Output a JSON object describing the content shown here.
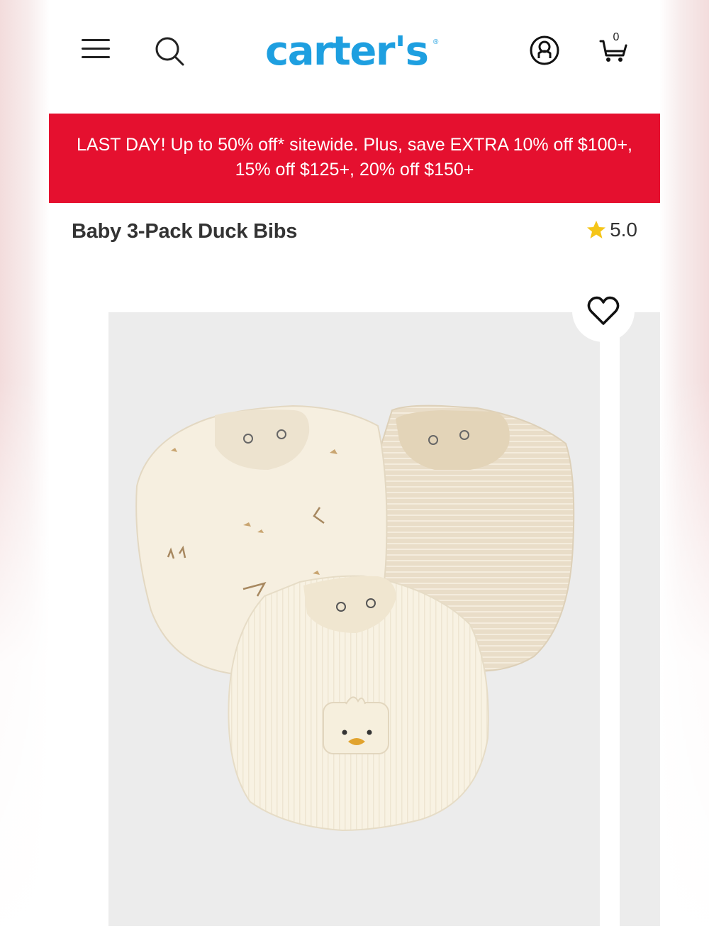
{
  "brand": {
    "name": "carter's",
    "registered_mark": "®"
  },
  "header": {
    "menu_icon": "hamburger-menu-icon",
    "search_icon": "search-icon",
    "account_icon": "account-icon",
    "cart_icon": "cart-icon",
    "cart_count": "0"
  },
  "promo": {
    "line1": "LAST DAY! Up to 50% off* sitewide. Plus, save EXTRA 10% off $100+,",
    "line2": "15% off $125+, 20% off $150+"
  },
  "product": {
    "title": "Baby 3-Pack Duck Bibs",
    "rating": "5.0",
    "rating_icon": "star-icon",
    "wishlist_icon": "heart-icon"
  },
  "colors": {
    "brand_blue": "#1e9fe0",
    "promo_red": "#e5102f",
    "star_yellow": "#f5c518",
    "image_bg": "#ececec"
  }
}
